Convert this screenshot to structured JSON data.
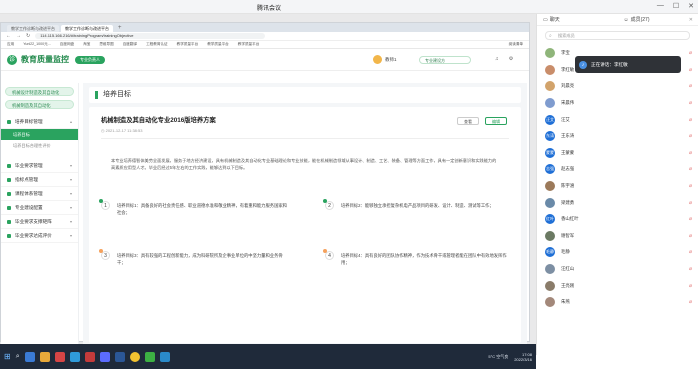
{
  "window": {
    "title": "腾讯会议"
  },
  "browser": {
    "tabs": [
      {
        "label": "教学工作诊断与改进平台"
      },
      {
        "label": "教学工作诊断与改进平台",
        "active": true
      }
    ],
    "url": "114.115.166.216/#/trainingProgram/trainingObjective",
    "bookmarks": [
      "应用",
      "Yunl22_1000元...",
      "百度网盘",
      "淘宝",
      "思维导图",
      "百度翻译",
      "工程教育认证",
      "教学质量平台",
      "教学质量平台",
      "教学质量平台"
    ],
    "bookmarks_right": "阅读清单"
  },
  "app": {
    "logo": "诊",
    "name": "教育质量监控",
    "role": "专业负责人",
    "user": "教师1",
    "year_select": "专业建设方",
    "sidebar": {
      "pills": [
        "机械设计制造及其自动化",
        "机械制造及其自动化"
      ],
      "menu": [
        {
          "label": "培养目标管理",
          "expanded": true
        },
        {
          "label": "培养目标",
          "sub": true,
          "active": true
        },
        {
          "label": "培养目标合理性评价",
          "sub": true
        },
        {
          "label": "毕业要求管理"
        },
        {
          "label": "指标点管理"
        },
        {
          "label": "课程体系管理"
        },
        {
          "label": "专业建设配置"
        },
        {
          "label": "毕业要求支撑矩阵"
        },
        {
          "label": "毕业要求达成评价"
        }
      ]
    },
    "page_heading": "培养目标",
    "program": {
      "title": "机械制造及其自动化专业2016版培养方案",
      "date": "2021-12-17 11:38:53",
      "btn_view": "查看",
      "btn_edit": "编辑",
      "description": "本专业培养德智体美劳全面发展，服务于地方经济建设，具有机械制造及其自动化专业基础理论和专业技能，能在机械制造领域从事设计、制造、工艺、装备、管理等方面工作，具有一定创新意识和实践能力的高素质应用型人才。毕业后经过5年左右的工作实践，能够达到以下目标。",
      "goals": [
        {
          "num": "1",
          "text": "培养目标1：具备良好的社会责任感、职业道德水准和敬业精神，有着重和能力服务国家和社会；",
          "color": "#2aa35f"
        },
        {
          "num": "2",
          "text": "培养目标2：能够独立承担复杂机电产品项目的研发、设计、制造、测试等工作；",
          "color": "#2aa35f"
        },
        {
          "num": "3",
          "text": "培养目标3：具有较强的工程创新能力，成为科研院所及企事业单位的中坚力量和业务骨干；",
          "color": "#f5a25d"
        },
        {
          "num": "4",
          "text": "培养目标4：具有良好的团队协作精神，作为技术骨干或管理者能在团队中有效地发挥作用；",
          "color": "#f5a25d"
        }
      ]
    }
  },
  "taskbar": {
    "weather": "5°C 空气良",
    "time": "17:08",
    "date": "2022/3/16"
  },
  "panel": {
    "tab_chat": "聊天",
    "tab_members": "成员(27)",
    "search_placeholder": "搜索成员",
    "speaking": "正在讲话：李红敏",
    "members": [
      {
        "name": "李宝",
        "color": "#8fb57a"
      },
      {
        "name": "李红敏",
        "color": "#c98d6a"
      },
      {
        "name": "刘晨亮",
        "color": "#d2a36b"
      },
      {
        "name": "宋晨伟",
        "color": "#7f9ccf"
      },
      {
        "name": "汪艾",
        "color": "#1f6fd6",
        "initial": "汪艾"
      },
      {
        "name": "王东涛",
        "color": "#1f6fd6",
        "initial": "东涛"
      },
      {
        "name": "王蒙蒙",
        "color": "#1f6fd6",
        "initial": "蒙蒙"
      },
      {
        "name": "赵志强",
        "color": "#1f6fd6",
        "initial": "志强"
      },
      {
        "name": "陈宇涵",
        "color": "#9c7a5a"
      },
      {
        "name": "梁建勇",
        "color": "#6a8aa8"
      },
      {
        "name": "香山红叶",
        "color": "#1f6fd6",
        "initial": "红叶"
      },
      {
        "name": "谢智军",
        "color": "#6b7a63"
      },
      {
        "name": "毛静",
        "color": "#1f6fd6",
        "initial": "毛静"
      },
      {
        "name": "汪红山",
        "color": "#7d8fa3"
      },
      {
        "name": "王亮刚",
        "color": "#8a7c6a"
      },
      {
        "name": "朱燕",
        "color": "#a3887a"
      }
    ]
  }
}
